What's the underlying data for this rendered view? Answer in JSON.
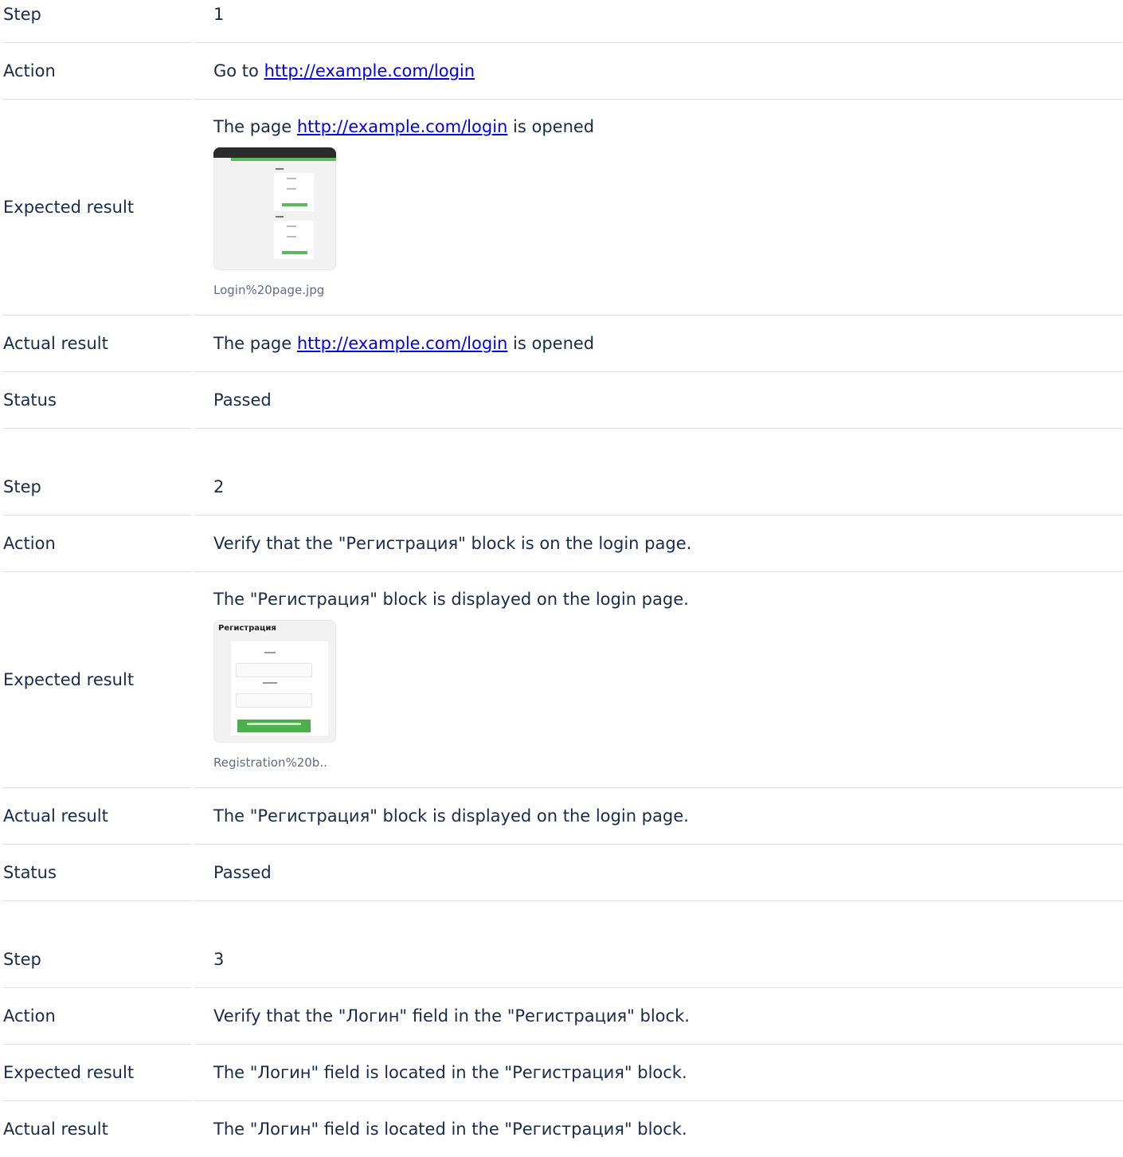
{
  "labels": {
    "step": "Step",
    "action": "Action",
    "expected": "Expected result",
    "actual": "Actual result",
    "status": "Status"
  },
  "steps": [
    {
      "step": "1",
      "action_prefix": "Go to ",
      "action_link": "http://example.com/login",
      "expected_prefix": "The page ",
      "expected_link": "http://example.com/login",
      "expected_suffix": " is opened",
      "expected_attachment": "Login%20page.jpg",
      "actual_prefix": "The page ",
      "actual_link": "http://example.com/login",
      "actual_suffix": " is opened",
      "status": "Passed"
    },
    {
      "step": "2",
      "action": "Verify that the \"Регистрация\" block is on the login page.",
      "expected": "The \"Регистрация\" block is displayed on the login page.",
      "expected_attachment": "Registration%20b..",
      "attachment_heading": "Регистрация",
      "actual": "The \"Регистрация\" block is displayed on the login page.",
      "status": "Passed"
    },
    {
      "step": "3",
      "action": "Verify that the \"Логин\" field in the \"Регистрация\" block.",
      "expected": "The \"Логин\" field is located in the \"Регистрация\" block.",
      "actual": "The \"Логин\" field is located in the \"Регистрация\" block."
    }
  ]
}
